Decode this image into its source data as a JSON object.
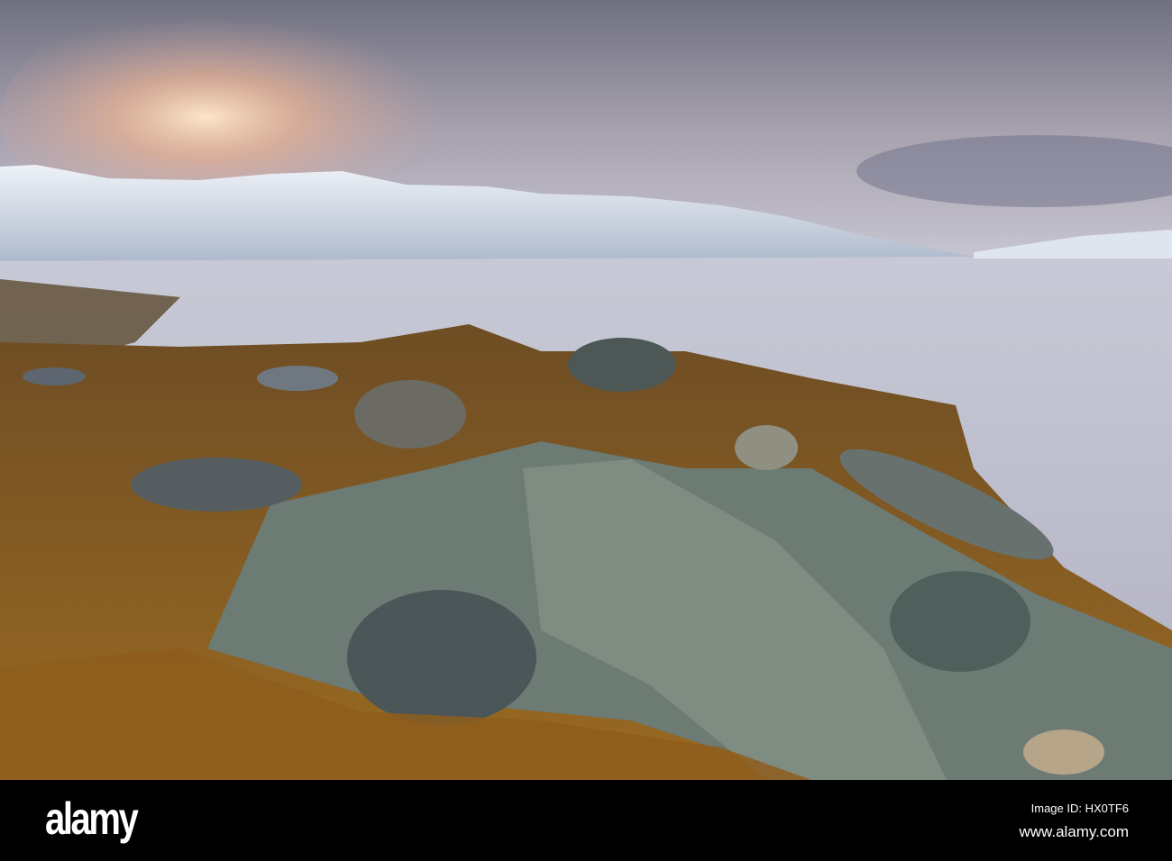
{
  "photo": {
    "subject": "snowy mountains over a fjord with rocky seaweed shoreline",
    "colors": {
      "sky": "#8c8e9c",
      "sunglow": "#f3c9a0",
      "snow": "#e4ecf4",
      "water": "#b8bccb",
      "seaweed": "#8a5a1e",
      "rock": "#5a6a66"
    }
  },
  "footer": {
    "logo": "alamy",
    "image_id": "Image ID: HX0TF6",
    "url": "www.alamy.com"
  }
}
